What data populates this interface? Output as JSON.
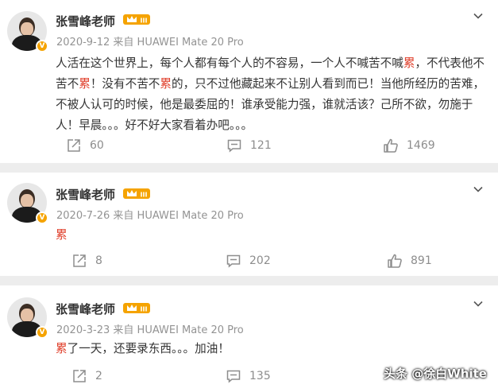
{
  "posts": [
    {
      "author": "张雪峰老师",
      "level": "III",
      "verified": "V",
      "meta": "2020-9-12  来自 HUAWEI Mate 20 Pro",
      "content_parts": [
        "人活在这个世界上，每个人都有每个人的不容易，一个人不喊苦不喊",
        "累",
        "，不代表他不苦不",
        "累",
        "！没有不苦不",
        "累",
        "的，只不过他藏起来不让别人看到而已！当他所经历的苦难，不被人认可的时候，他是最委屈的！谁承受能力强，谁就活该？己所不欲，勿施于人！早晨。。。好不好大家看着办吧。。。"
      ],
      "reposts": "60",
      "comments": "121",
      "likes": "1469"
    },
    {
      "author": "张雪峰老师",
      "level": "III",
      "verified": "V",
      "meta": "2020-7-26  来自 HUAWEI Mate 20 Pro",
      "content_parts": [
        "累"
      ],
      "reposts": "8",
      "comments": "202",
      "likes": "891"
    },
    {
      "author": "张雪峰老师",
      "level": "III",
      "verified": "V",
      "meta": "2020-3-23  来自 HUAWEI Mate 20 Pro",
      "content_parts": [
        "累",
        "了一天，还要录东西。。。加油！"
      ],
      "reposts": "2",
      "comments": "135",
      "likes": ""
    }
  ],
  "watermark": "头条 @徐白White",
  "colors": {
    "highlight": "#e0402c",
    "crown": "#f5a300",
    "meta": "#939393",
    "action": "#8d8d8d"
  },
  "icons": [
    "chevron-down-icon",
    "repost-icon",
    "comment-icon",
    "like-icon",
    "crown-icon",
    "verified-icon"
  ]
}
